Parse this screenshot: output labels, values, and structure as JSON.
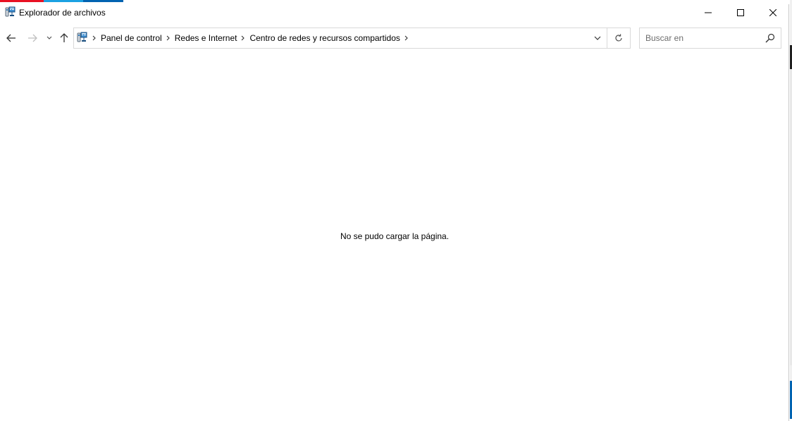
{
  "colors": {
    "stripe_red": "#e81123",
    "stripe_cyan": "#1ba1e2",
    "stripe_blue": "#0063b1",
    "border": "#d9d9d9",
    "placeholder": "#6d6d6d"
  },
  "window": {
    "title": "Explorador de archivos",
    "app_icon": "control-panel-network-icon"
  },
  "caption_buttons": {
    "minimize_icon": "minimize-icon",
    "maximize_icon": "maximize-icon",
    "close_icon": "close-icon"
  },
  "navigation": {
    "back_icon": "arrow-left-icon",
    "forward_icon": "arrow-right-icon",
    "recent_icon": "chevron-down-icon",
    "up_icon": "arrow-up-icon"
  },
  "address": {
    "icon": "control-panel-network-icon",
    "breadcrumbs": [
      "Panel de control",
      "Redes e Internet",
      "Centro de redes y recursos compartidos"
    ],
    "dropdown_icon": "chevron-down-icon",
    "refresh_icon": "refresh-icon"
  },
  "search": {
    "placeholder": "Buscar en",
    "icon": "search-icon"
  },
  "content": {
    "message": "No se pudo cargar la página."
  }
}
